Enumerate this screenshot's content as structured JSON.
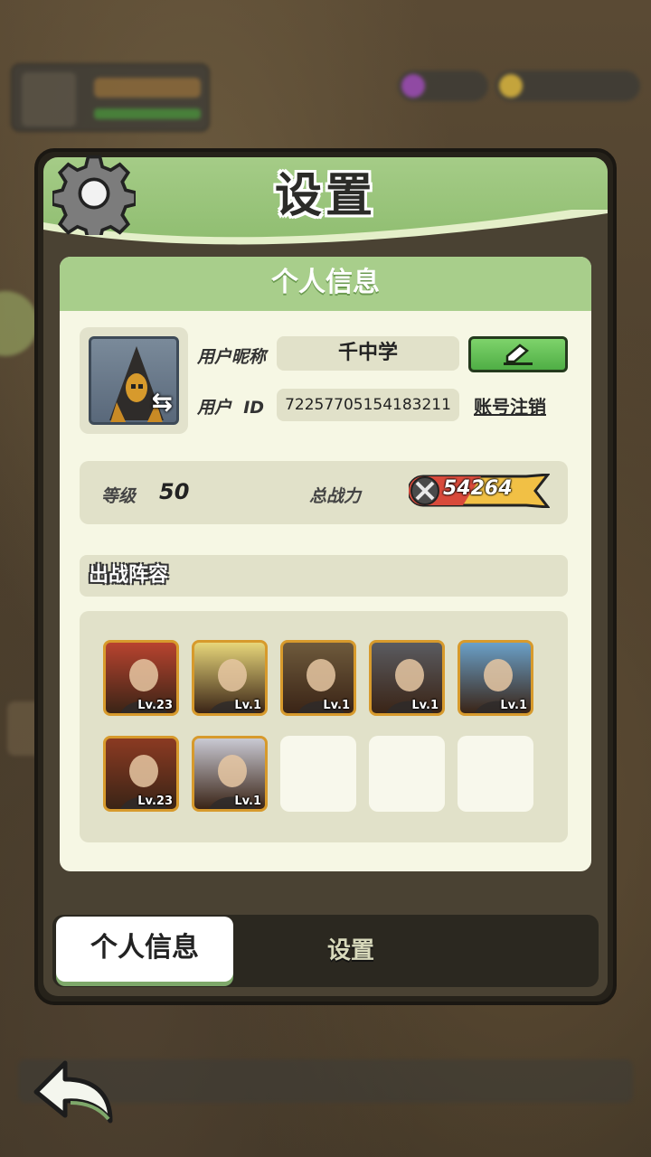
{
  "header": {
    "title": "设置"
  },
  "profile": {
    "section_title": "个人信息",
    "nickname_label": "用户昵称",
    "nickname_value": "千中学",
    "id_label": "用户  ID",
    "id_value": "72257705154183211",
    "cancel_account": "账号注销"
  },
  "stats": {
    "level_label": "等级",
    "level_value": "50",
    "power_label": "总战力",
    "power_value": "54264"
  },
  "lineup": {
    "title": "出战阵容",
    "heroes": [
      {
        "level": "Lv.23",
        "color": "#b8432f"
      },
      {
        "level": "Lv.1",
        "color": "#e7d67a"
      },
      {
        "level": "Lv.1",
        "color": "#6e5a3c"
      },
      {
        "level": "Lv.1",
        "color": "#5a5b60"
      },
      {
        "level": "Lv.1",
        "color": "#6aa0c8"
      },
      {
        "level": "Lv.23",
        "color": "#8b3a22"
      },
      {
        "level": "Lv.1",
        "color": "#c9c9d3"
      }
    ]
  },
  "tabs": {
    "active": "个人信息",
    "other": "设置"
  },
  "colors": {
    "accent_green": "#a8ce8b",
    "card_bg": "#f6f7e4",
    "hero_border": "#d79a2c"
  },
  "icons": [
    "gear-icon",
    "swap-icon",
    "edit-icon",
    "sword-icon",
    "back-arrow-icon"
  ]
}
